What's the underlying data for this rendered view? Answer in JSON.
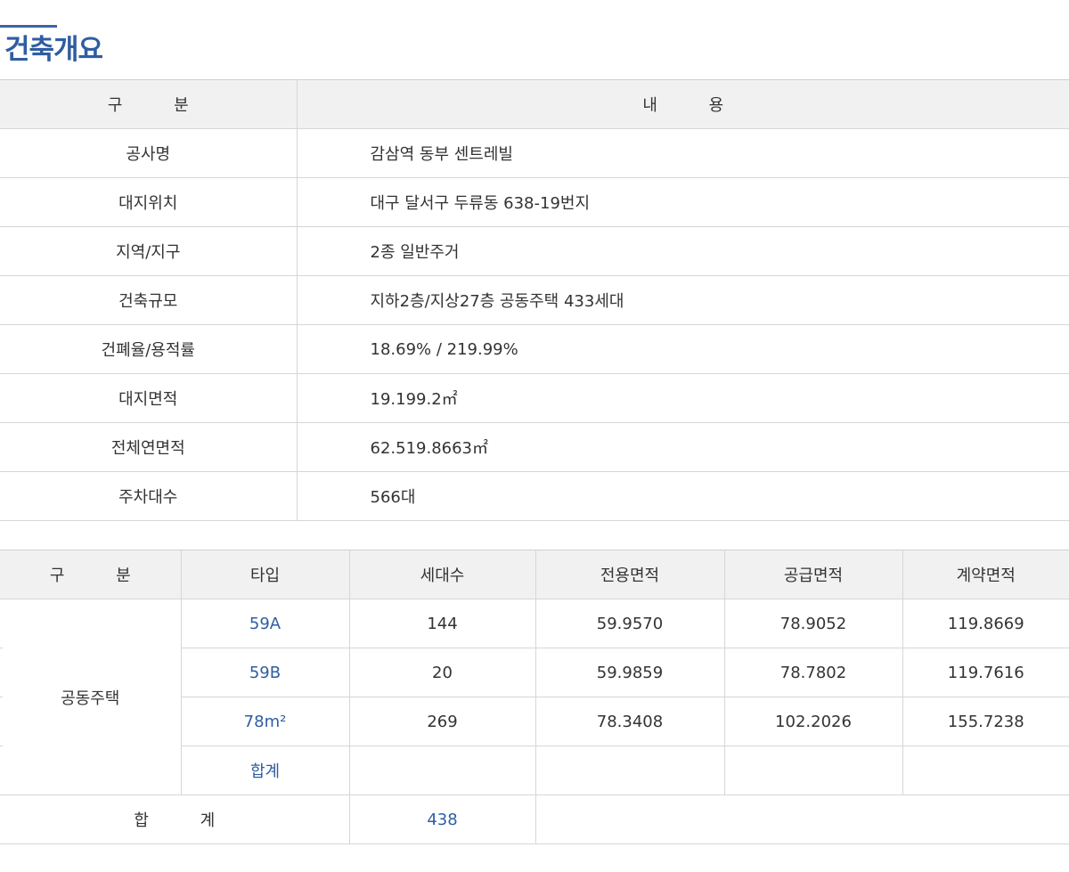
{
  "section_title": "건축개요",
  "overview": {
    "header": {
      "label": "구 분",
      "value": "내 용"
    },
    "rows": [
      {
        "label": "공사명",
        "value": "감삼역 동부 센트레빌"
      },
      {
        "label": "대지위치",
        "value": "대구 달서구 두류동 638-19번지"
      },
      {
        "label": "지역/지구",
        "value": "2종 일반주거"
      },
      {
        "label": "건축규모",
        "value": "지하2층/지상27층 공동주택 433세대"
      },
      {
        "label": "건폐율/용적률",
        "value": "18.69% / 219.99%"
      },
      {
        "label": "대지면적",
        "value": "19.199.2㎡"
      },
      {
        "label": "전체연면적",
        "value": "62.519.8663㎡"
      },
      {
        "label": "주차대수",
        "value": "566대"
      }
    ]
  },
  "types": {
    "headers": [
      "구 분",
      "타입",
      "세대수",
      "전용면적",
      "공급면적",
      "계약면적"
    ],
    "group": "공동주택",
    "rows": [
      {
        "type": "59A",
        "units": "144",
        "exclusive": "59.9570",
        "supply": "78.9052",
        "contract": "119.8669"
      },
      {
        "type": "59B",
        "units": "20",
        "exclusive": "59.9859",
        "supply": "78.7802",
        "contract": "119.7616"
      },
      {
        "type": "78m²",
        "units": "269",
        "exclusive": "78.3408",
        "supply": "102.2026",
        "contract": "155.7238"
      },
      {
        "type": "합계",
        "units": "",
        "exclusive": "",
        "supply": "",
        "contract": ""
      }
    ],
    "total": {
      "label": "합 계",
      "units": "438"
    }
  },
  "colors": {
    "accent": "#2f5da2",
    "header_bg": "#f1f1f1",
    "border": "#d6d6d6"
  }
}
